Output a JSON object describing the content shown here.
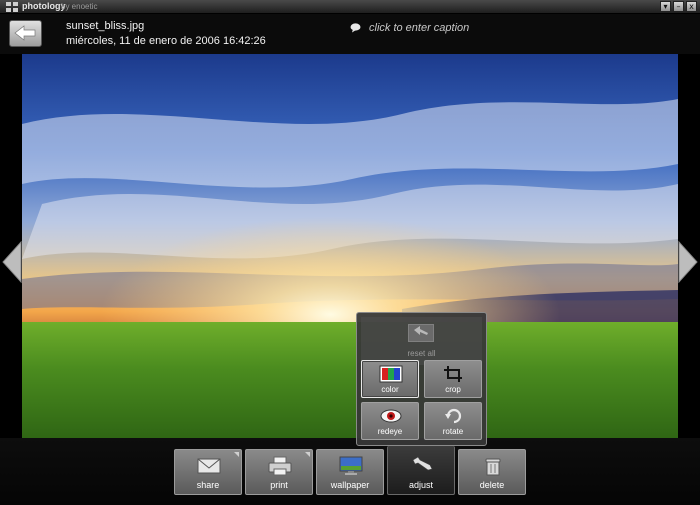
{
  "app": {
    "name": "photology",
    "by": "by enoetic"
  },
  "window_controls": {
    "dropdown": "▾",
    "minimize": "–",
    "close": "x"
  },
  "photo_info": {
    "filename": "sunset_bliss.jpg",
    "datetime": "miércoles, 11 de enero de 2006 16:42:26",
    "caption_placeholder": "click to enter caption"
  },
  "toolbar": {
    "share": "share",
    "print": "print",
    "wallpaper": "wallpaper",
    "adjust": "adjust",
    "delete": "delete"
  },
  "adjust_panel": {
    "reset_all": "reset all",
    "color": "color",
    "crop": "crop",
    "redeye": "redeye",
    "rotate": "rotate"
  },
  "colors": {
    "background": "#000000",
    "sky_blue": "#2c4fa8",
    "sunset_orange": "#f3b24a",
    "grass_green": "#5c9e24"
  }
}
